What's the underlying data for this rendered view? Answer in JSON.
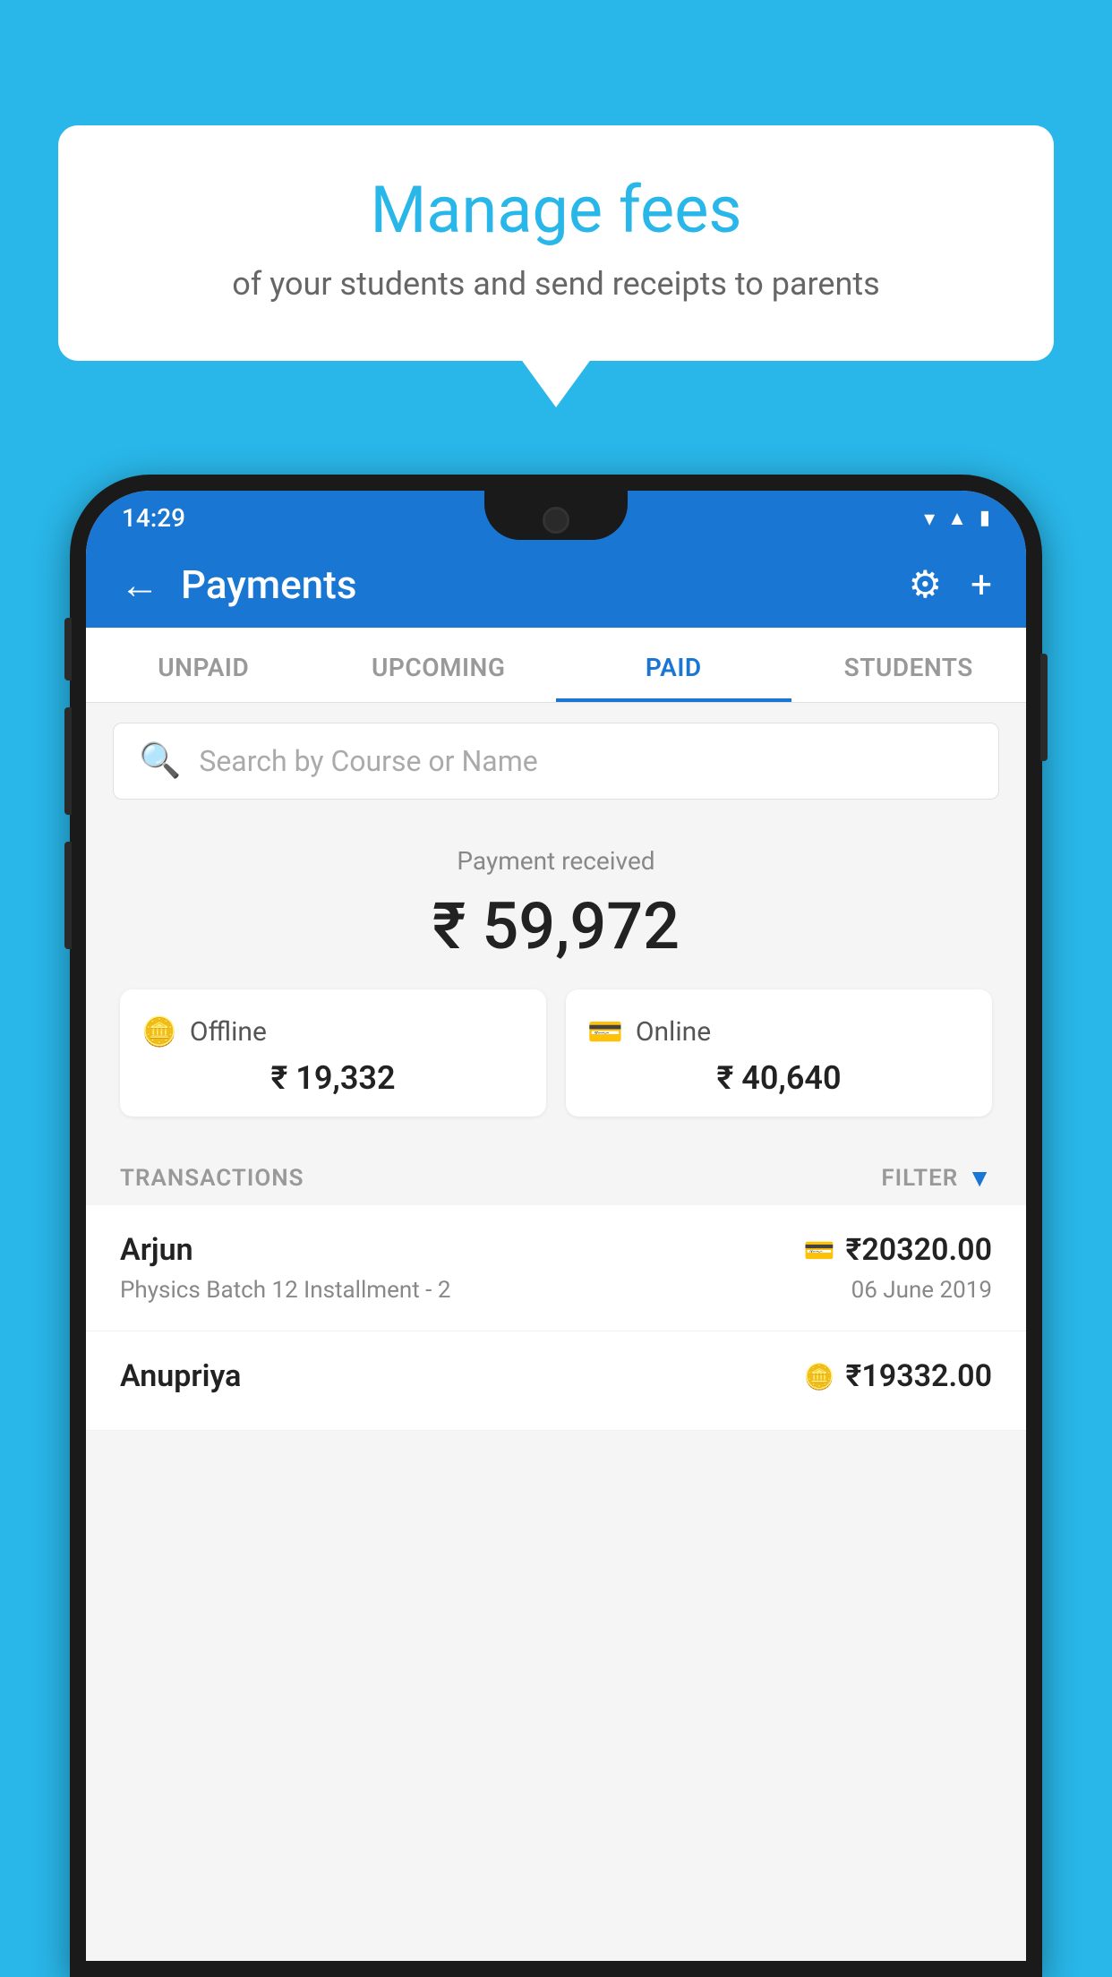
{
  "bubble": {
    "title": "Manage fees",
    "subtitle": "of your students and send receipts to parents"
  },
  "statusBar": {
    "time": "14:29"
  },
  "appBar": {
    "title": "Payments",
    "backLabel": "←",
    "settingsLabel": "⚙",
    "addLabel": "+"
  },
  "tabs": [
    {
      "label": "UNPAID",
      "active": false
    },
    {
      "label": "UPCOMING",
      "active": false
    },
    {
      "label": "PAID",
      "active": true
    },
    {
      "label": "STUDENTS",
      "active": false
    }
  ],
  "search": {
    "placeholder": "Search by Course or Name"
  },
  "paymentSummary": {
    "label": "Payment received",
    "amount": "₹ 59,972",
    "offline": {
      "type": "Offline",
      "amount": "₹ 19,332"
    },
    "online": {
      "type": "Online",
      "amount": "₹ 40,640"
    }
  },
  "transactions": {
    "headerLabel": "TRANSACTIONS",
    "filterLabel": "FILTER",
    "rows": [
      {
        "name": "Arjun",
        "course": "Physics Batch 12 Installment - 2",
        "amount": "₹20320.00",
        "date": "06 June 2019",
        "paymentType": "online"
      },
      {
        "name": "Anupriya",
        "course": "",
        "amount": "₹19332.00",
        "date": "",
        "paymentType": "offline"
      }
    ]
  }
}
